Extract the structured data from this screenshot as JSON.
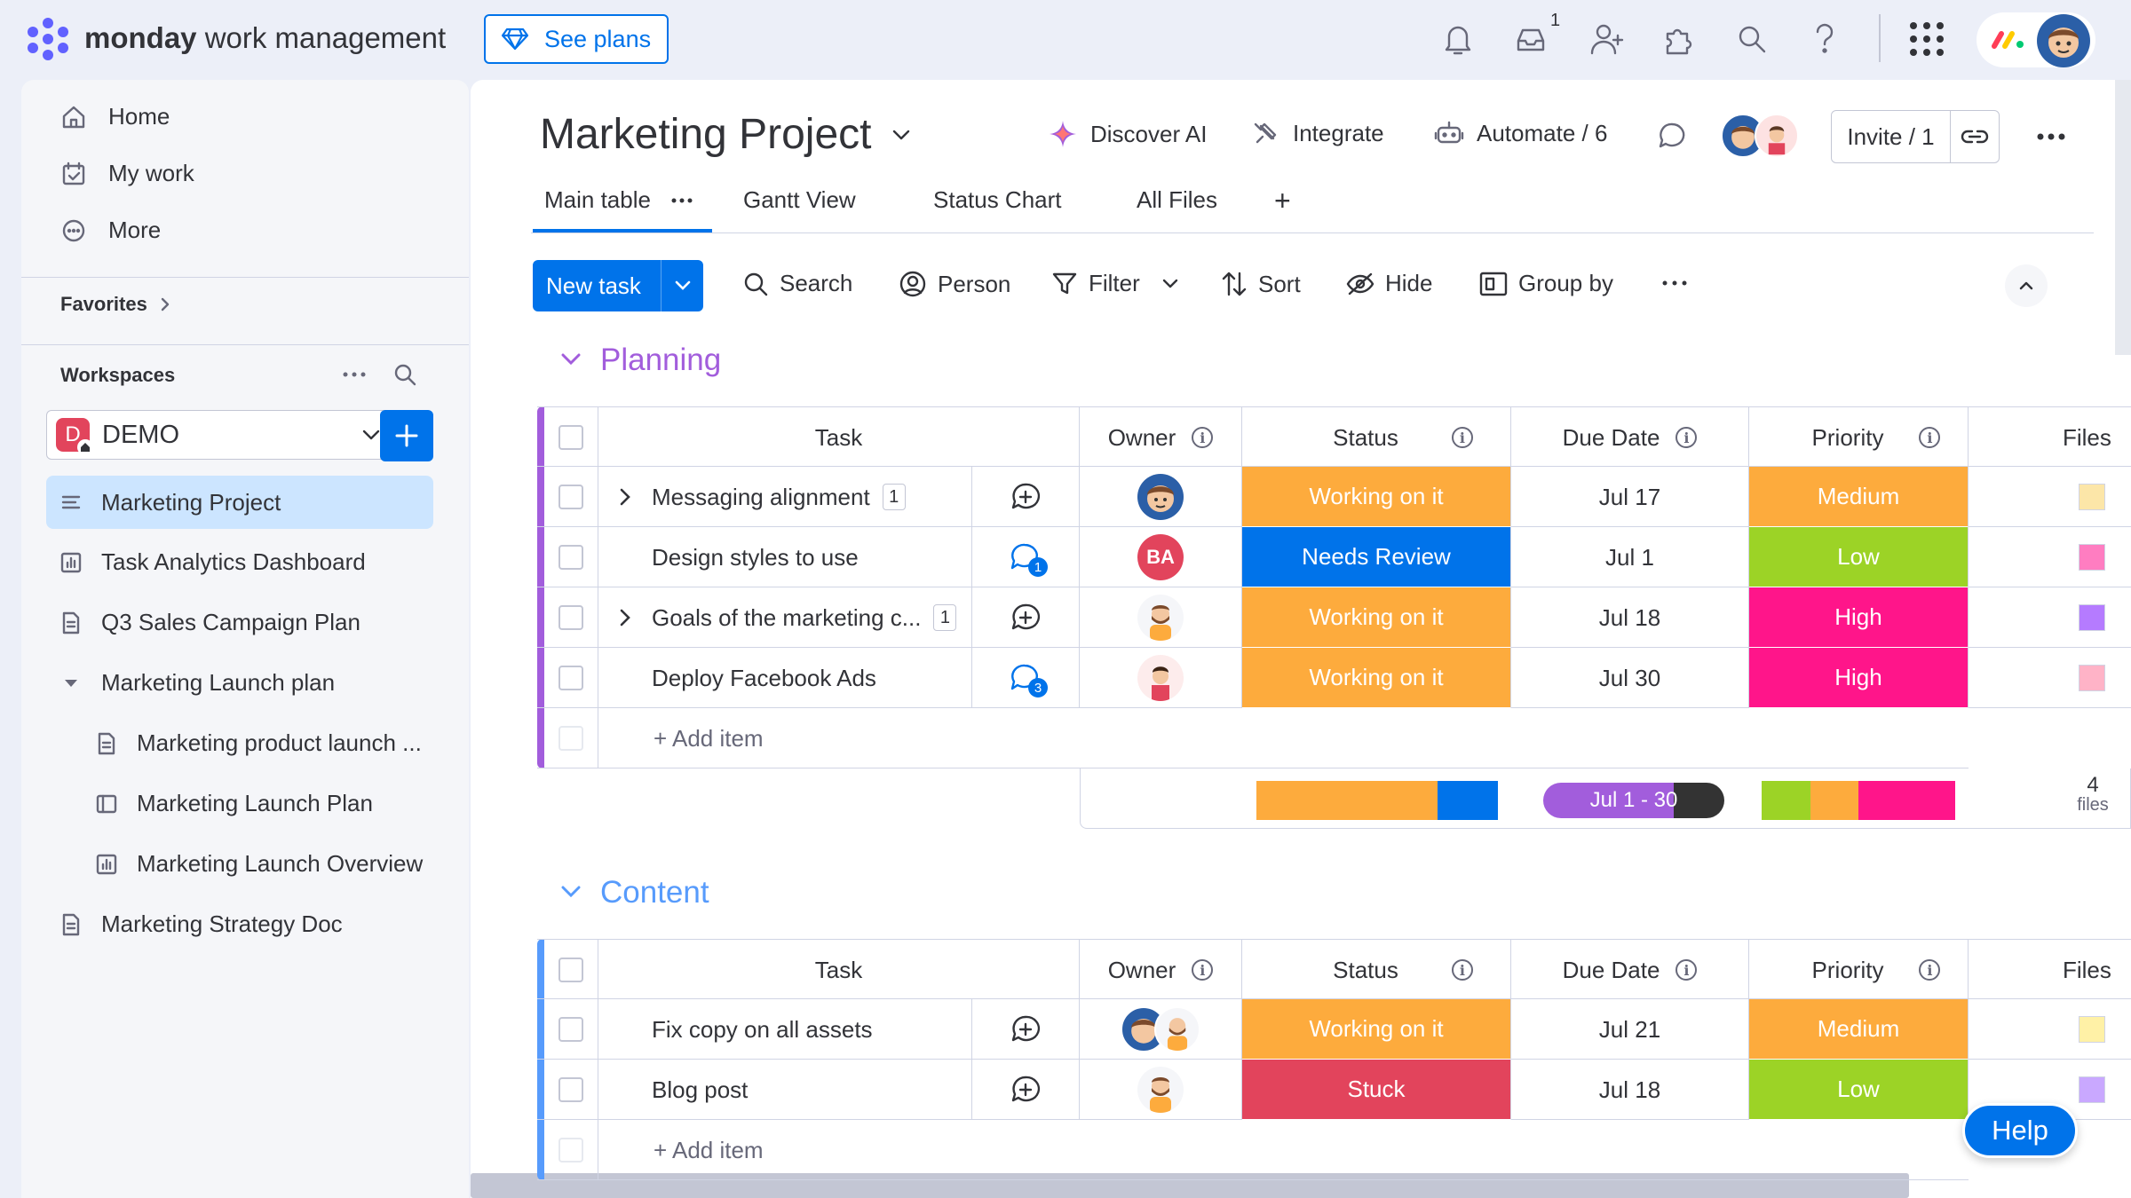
{
  "topbar": {
    "brand_bold": "monday",
    "brand_rest": " work management",
    "see_plans": "See plans",
    "inbox_badge": "1"
  },
  "sidebar": {
    "nav": [
      "Home",
      "My work",
      "More"
    ],
    "favorites": "Favorites",
    "workspaces": "Workspaces",
    "workspace_letter": "D",
    "workspace_name": "DEMO",
    "boards": [
      {
        "label": "Marketing Project",
        "icon": "board-icon"
      },
      {
        "label": "Task Analytics Dashboard",
        "icon": "dashboard-icon"
      },
      {
        "label": "Q3 Sales Campaign Plan",
        "icon": "doc-icon"
      },
      {
        "label": "Marketing Launch plan",
        "icon": "folder-caret-icon"
      },
      {
        "label": "Marketing product launch ...",
        "icon": "doc-icon"
      },
      {
        "label": "Marketing Launch Plan",
        "icon": "board-icon"
      },
      {
        "label": "Marketing Launch Overview",
        "icon": "dashboard-icon"
      },
      {
        "label": "Marketing Strategy Doc",
        "icon": "doc-icon"
      }
    ]
  },
  "board": {
    "title": "Marketing Project",
    "discover_ai": "Discover AI",
    "integrate": "Integrate",
    "automate": "Automate / 6",
    "invite": "Invite / 1",
    "tabs": [
      "Main table",
      "Gantt View",
      "Status Chart",
      "All Files"
    ],
    "tab_add": "+"
  },
  "toolbar": {
    "new_task": "New task",
    "search": "Search",
    "person": "Person",
    "filter": "Filter",
    "sort": "Sort",
    "hide": "Hide",
    "group_by": "Group by"
  },
  "columns": [
    "Task",
    "Owner",
    "Status",
    "Due Date",
    "Priority",
    "Files"
  ],
  "colors": {
    "working": "#fdab3d",
    "review": "#0073ea",
    "stuck": "#e2445c",
    "medium": "#fdab3d",
    "low": "#9cd326",
    "high": "#ff158a",
    "planning": "#a25ddc",
    "content": "#579bfc"
  },
  "groups": [
    {
      "name": "Planning",
      "color": "#a25ddc",
      "items": [
        {
          "task": "Messaging alignment",
          "count": "1",
          "expand": true,
          "comments": "",
          "owner": "man-avatar",
          "status": "Working on it",
          "status_color": "#fdab3d",
          "due": "Jul 17",
          "priority": "Medium",
          "priority_color": "#fdab3d"
        },
        {
          "task": "Design styles to use",
          "count": "",
          "expand": false,
          "comments": "1",
          "owner": "BA",
          "status": "Needs Review",
          "status_color": "#0073ea",
          "due": "Jul 1",
          "priority": "Low",
          "priority_color": "#9cd326"
        },
        {
          "task": "Goals of the marketing c...",
          "count": "1",
          "expand": true,
          "comments": "",
          "owner": "bearded-avatar",
          "status": "Working on it",
          "status_color": "#fdab3d",
          "due": "Jul 18",
          "priority": "High",
          "priority_color": "#ff158a"
        },
        {
          "task": "Deploy Facebook Ads",
          "count": "",
          "expand": false,
          "comments": "3",
          "owner": "red-avatar",
          "status": "Working on it",
          "status_color": "#fdab3d",
          "due": "Jul 30",
          "priority": "High",
          "priority_color": "#ff158a"
        }
      ],
      "add_item": "+ Add item",
      "summary": {
        "timeline": "Jul 1 - 30",
        "files_count": "4",
        "files_label": "files"
      }
    },
    {
      "name": "Content",
      "color": "#579bfc",
      "items": [
        {
          "task": "Fix copy on all assets",
          "count": "",
          "expand": false,
          "comments": "",
          "owner": "two-avatars",
          "status": "Working on it",
          "status_color": "#fdab3d",
          "due": "Jul 21",
          "priority": "Medium",
          "priority_color": "#fdab3d"
        },
        {
          "task": "Blog post",
          "count": "",
          "expand": false,
          "comments": "",
          "owner": "bearded-avatar",
          "status": "Stuck",
          "status_color": "#e2445c",
          "due": "Jul 18",
          "priority": "Low",
          "priority_color": "#9cd326"
        }
      ],
      "add_item": "+ Add item"
    }
  ],
  "help": "Help"
}
